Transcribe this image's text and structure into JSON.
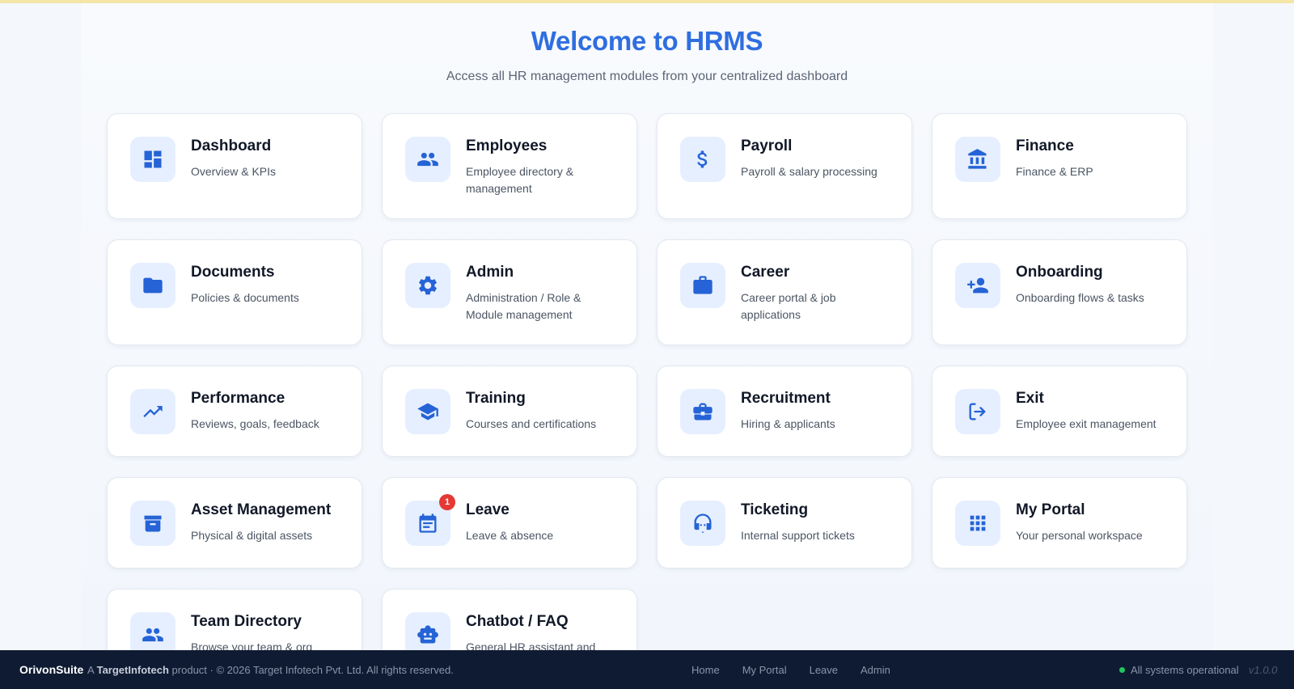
{
  "hero": {
    "title": "Welcome to HRMS",
    "subtitle": "Access all HR management modules from your centralized dashboard"
  },
  "modules": [
    {
      "title": "Dashboard",
      "desc": "Overview & KPIs",
      "icon": "dashboard-icon"
    },
    {
      "title": "Employees",
      "desc": "Employee directory & management",
      "icon": "people-icon"
    },
    {
      "title": "Payroll",
      "desc": "Payroll & salary processing",
      "icon": "dollar-icon"
    },
    {
      "title": "Finance",
      "desc": "Finance & ERP",
      "icon": "bank-icon"
    },
    {
      "title": "Documents",
      "desc": "Policies & documents",
      "icon": "folder-icon"
    },
    {
      "title": "Admin",
      "desc": "Administration / Role & Module management",
      "icon": "gear-icon"
    },
    {
      "title": "Career",
      "desc": "Career portal & job applications",
      "icon": "briefcase-icon"
    },
    {
      "title": "Onboarding",
      "desc": "Onboarding flows & tasks",
      "icon": "person-add-icon"
    },
    {
      "title": "Performance",
      "desc": "Reviews, goals, feedback",
      "icon": "trending-up-icon"
    },
    {
      "title": "Training",
      "desc": "Courses and certifications",
      "icon": "graduation-cap-icon"
    },
    {
      "title": "Recruitment",
      "desc": "Hiring & applicants",
      "icon": "business-case-icon"
    },
    {
      "title": "Exit",
      "desc": "Employee exit management",
      "icon": "logout-icon"
    },
    {
      "title": "Asset Management",
      "desc": "Physical & digital assets",
      "icon": "archive-icon"
    },
    {
      "title": "Leave",
      "desc": "Leave & absence",
      "icon": "calendar-icon",
      "badge": "1"
    },
    {
      "title": "Ticketing",
      "desc": "Internal support tickets",
      "icon": "headset-icon"
    },
    {
      "title": "My Portal",
      "desc": "Your personal workspace",
      "icon": "apps-grid-icon"
    },
    {
      "title": "Team Directory",
      "desc": "Browse your team & org",
      "icon": "people-icon"
    },
    {
      "title": "Chatbot / FAQ",
      "desc": "General HR assistant and",
      "icon": "robot-icon"
    }
  ],
  "footer": {
    "brand": "OrivonSuite",
    "copyright_prefix": "A",
    "copyright_company": "TargetInfotech",
    "copyright_suffix": "product · © 2026 Target Infotech Pvt. Ltd. All rights reserved.",
    "links": [
      "Home",
      "My Portal",
      "Leave",
      "Admin"
    ],
    "status": "All systems operational",
    "version": "v1.0.0"
  },
  "colors": {
    "accent": "#2f6ee0",
    "icon": "#2563d6",
    "icon_bg": "#e6efff",
    "badge": "#e53935",
    "footer_bg": "#0f1b33",
    "status_ok": "#22c55e"
  }
}
